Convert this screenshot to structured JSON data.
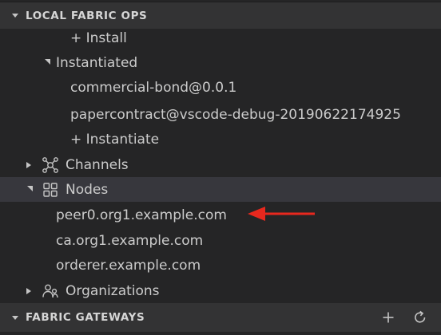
{
  "sections": {
    "local_ops": {
      "title": "LOCAL FABRIC OPS"
    },
    "gateways": {
      "title": "FABRIC GATEWAYS"
    }
  },
  "tree": {
    "install": "+ Install",
    "instantiated": "Instantiated",
    "contracts": [
      "commercial-bond@0.0.1",
      "papercontract@vscode-debug-20190622174925"
    ],
    "instantiate": "+ Instantiate",
    "channels": "Channels",
    "nodes": "Nodes",
    "node_items": [
      "peer0.org1.example.com",
      "ca.org1.example.com",
      "orderer.example.com"
    ],
    "organizations": "Organizations"
  },
  "icons": {
    "channels": "network-nodes-icon",
    "nodes": "grid-icon",
    "organizations": "people-icon",
    "add": "plus-icon",
    "refresh": "refresh-icon",
    "annotation": "red-arrow-icon"
  },
  "colors": {
    "background": "#252526",
    "header": "#333334",
    "selected_row": "#37373d",
    "text": "#cccccc",
    "arrow": "#e8281e"
  }
}
